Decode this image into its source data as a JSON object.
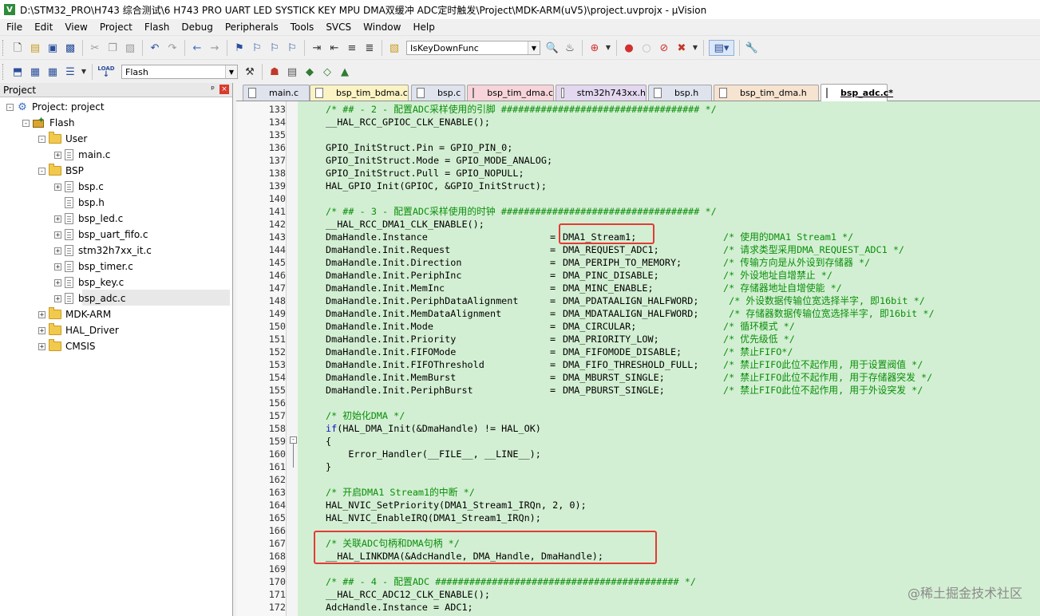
{
  "window": {
    "title": "D:\\STM32_PRO\\H743 综合测试\\6 H743 PRO UART LED SYSTICK KEY MPU DMA双缓冲 ADC定时触发\\Project\\MDK-ARM(uV5)\\project.uvprojx - µVision",
    "app_icon": "V"
  },
  "menu": [
    "File",
    "Edit",
    "View",
    "Project",
    "Flash",
    "Debug",
    "Peripherals",
    "Tools",
    "SVCS",
    "Window",
    "Help"
  ],
  "toolbar": {
    "find_combo_value": "IsKeyDownFunc",
    "target_combo_value": "Flash",
    "load_label": "LOAD"
  },
  "project_panel": {
    "header": "Project",
    "pin_glyph": "ᵖ",
    "close_glyph": "×",
    "tree": [
      {
        "label": "Project: project",
        "level": 0,
        "expander": "-",
        "icon": "project-icon"
      },
      {
        "label": "Flash",
        "level": 1,
        "expander": "-",
        "icon": "target-icon"
      },
      {
        "label": "User",
        "level": 2,
        "expander": "-",
        "icon": "folder-icon"
      },
      {
        "label": "main.c",
        "level": 3,
        "expander": "+",
        "icon": "file-icon"
      },
      {
        "label": "BSP",
        "level": 2,
        "expander": "-",
        "icon": "folder-icon"
      },
      {
        "label": "bsp.c",
        "level": 3,
        "expander": "+",
        "icon": "file-icon"
      },
      {
        "label": "bsp.h",
        "level": 3,
        "expander": "",
        "icon": "file-icon"
      },
      {
        "label": "bsp_led.c",
        "level": 3,
        "expander": "+",
        "icon": "file-icon"
      },
      {
        "label": "bsp_uart_fifo.c",
        "level": 3,
        "expander": "+",
        "icon": "file-icon"
      },
      {
        "label": "stm32h7xx_it.c",
        "level": 3,
        "expander": "+",
        "icon": "file-icon"
      },
      {
        "label": "bsp_timer.c",
        "level": 3,
        "expander": "+",
        "icon": "file-icon"
      },
      {
        "label": "bsp_key.c",
        "level": 3,
        "expander": "+",
        "icon": "file-icon"
      },
      {
        "label": "bsp_adc.c",
        "level": 3,
        "expander": "+",
        "icon": "file-icon"
      },
      {
        "label": "MDK-ARM",
        "level": 2,
        "expander": "+",
        "icon": "folder-icon"
      },
      {
        "label": "HAL_Driver",
        "level": 2,
        "expander": "+",
        "icon": "folder-icon"
      },
      {
        "label": "CMSIS",
        "level": 2,
        "expander": "+",
        "icon": "folder-icon"
      }
    ]
  },
  "tabs": [
    {
      "label": "main.c",
      "color": "#dfe3ee",
      "active": false
    },
    {
      "label": "bsp_tim_bdma.c",
      "color": "#fbf3c4",
      "active": false
    },
    {
      "label": "bsp.c",
      "color": "#dfe3ee",
      "active": false
    },
    {
      "label": "bsp_tim_dma.c",
      "color": "#f7d4da",
      "active": false
    },
    {
      "label": "stm32h743xx.h",
      "color": "#e4d8f0",
      "active": false
    },
    {
      "label": "bsp.h",
      "color": "#dfe3ee",
      "active": false
    },
    {
      "label": "bsp_tim_dma.h",
      "color": "#f6e3d0",
      "active": false
    },
    {
      "label": "bsp_adc.c*",
      "color": "#ffffff",
      "active": true
    }
  ],
  "editor": {
    "background": "#d3efd3",
    "lines": [
      {
        "n": "133",
        "code": "/* ## - 2 - 配置ADC采样使用的引脚 ################################### */",
        "cls": "cm"
      },
      {
        "n": "134",
        "code": "__HAL_RCC_GPIOC_CLK_ENABLE();",
        "cls": ""
      },
      {
        "n": "135",
        "code": "",
        "cls": ""
      },
      {
        "n": "136",
        "code": "GPIO_InitStruct.Pin = GPIO_PIN_0;",
        "cls": ""
      },
      {
        "n": "137",
        "code": "GPIO_InitStruct.Mode = GPIO_MODE_ANALOG;",
        "cls": ""
      },
      {
        "n": "138",
        "code": "GPIO_InitStruct.Pull = GPIO_NOPULL;",
        "cls": ""
      },
      {
        "n": "139",
        "code": "HAL_GPIO_Init(GPIOC, &GPIO_InitStruct);",
        "cls": ""
      },
      {
        "n": "140",
        "code": "",
        "cls": ""
      },
      {
        "n": "141",
        "code": "/* ## - 3 - 配置ADC采样使用的时钟 ################################### */",
        "cls": "cm"
      },
      {
        "n": "142",
        "code": "__HAL_RCC_DMA1_CLK_ENABLE();",
        "cls": ""
      },
      {
        "n": "143",
        "code": "DmaHandle.Instance",
        "val": "DMA1_Stream1;",
        "cmt": "/* 使用的DMA1 Stream1 */"
      },
      {
        "n": "144",
        "code": "DmaHandle.Init.Request",
        "val": "DMA_REQUEST_ADC1;",
        "cmt": "/* 请求类型采用DMA_REQUEST_ADC1 */"
      },
      {
        "n": "145",
        "code": "DmaHandle.Init.Direction",
        "val": "DMA_PERIPH_TO_MEMORY;",
        "cmt": "/* 传输方向是从外设到存储器 */"
      },
      {
        "n": "146",
        "code": "DmaHandle.Init.PeriphInc",
        "val": "DMA_PINC_DISABLE;",
        "cmt": "/* 外设地址自增禁止 */"
      },
      {
        "n": "147",
        "code": "DmaHandle.Init.MemInc",
        "val": "DMA_MINC_ENABLE;",
        "cmt": "/* 存储器地址自增使能 */"
      },
      {
        "n": "148",
        "code": "DmaHandle.Init.PeriphDataAlignment",
        "val": "DMA_PDATAALIGN_HALFWORD;",
        "cmt": " /* 外设数据传输位宽选择半字, 即16bit */"
      },
      {
        "n": "149",
        "code": "DmaHandle.Init.MemDataAlignment",
        "val": "DMA_MDATAALIGN_HALFWORD;",
        "cmt": " /* 存储器数据传输位宽选择半字, 即16bit */"
      },
      {
        "n": "150",
        "code": "DmaHandle.Init.Mode",
        "val": "DMA_CIRCULAR;",
        "cmt": "/* 循环模式 */"
      },
      {
        "n": "151",
        "code": "DmaHandle.Init.Priority",
        "val": "DMA_PRIORITY_LOW;",
        "cmt": "/* 优先级低 */"
      },
      {
        "n": "152",
        "code": "DmaHandle.Init.FIFOMode",
        "val": "DMA_FIFOMODE_DISABLE;",
        "cmt": "/* 禁止FIFO*/"
      },
      {
        "n": "153",
        "code": "DmaHandle.Init.FIFOThreshold",
        "val": "DMA_FIFO_THRESHOLD_FULL;",
        "cmt": "/* 禁止FIFO此位不起作用, 用于设置阀值 */"
      },
      {
        "n": "154",
        "code": "DmaHandle.Init.MemBurst",
        "val": "DMA_MBURST_SINGLE;",
        "cmt": "/* 禁止FIFO此位不起作用, 用于存储器突发 */"
      },
      {
        "n": "155",
        "code": "DmaHandle.Init.PeriphBurst",
        "val": "DMA_PBURST_SINGLE;",
        "cmt": "/* 禁止FIFO此位不起作用, 用于外设突发 */"
      },
      {
        "n": "156",
        "code": "",
        "cls": ""
      },
      {
        "n": "157",
        "code": "/* 初始化DMA */",
        "cls": "cm"
      },
      {
        "n": "158",
        "code": "if(HAL_DMA_Init(&DmaHandle) != HAL_OK)",
        "cls": "if"
      },
      {
        "n": "159",
        "code": "{",
        "cls": ""
      },
      {
        "n": "160",
        "code": "    Error_Handler(__FILE__, __LINE__);",
        "cls": ""
      },
      {
        "n": "161",
        "code": "}",
        "cls": ""
      },
      {
        "n": "162",
        "code": "",
        "cls": ""
      },
      {
        "n": "163",
        "code": "/* 开启DMA1 Stream1的中断 */",
        "cls": "cm"
      },
      {
        "n": "164",
        "code": "HAL_NVIC_SetPriority(DMA1_Stream1_IRQn, 2, 0);",
        "cls": ""
      },
      {
        "n": "165",
        "code": "HAL_NVIC_EnableIRQ(DMA1_Stream1_IRQn);",
        "cls": ""
      },
      {
        "n": "166",
        "code": "",
        "cls": ""
      },
      {
        "n": "167",
        "code": "/* 关联ADC句柄和DMA句柄 */",
        "cls": "cm"
      },
      {
        "n": "168",
        "code": "__HAL_LINKDMA(&AdcHandle, DMA_Handle, DmaHandle);",
        "cls": ""
      },
      {
        "n": "169",
        "code": "",
        "cls": ""
      },
      {
        "n": "170",
        "code": "/* ## - 4 - 配置ADC ########################################### */",
        "cls": "cm"
      },
      {
        "n": "171",
        "code": "__HAL_RCC_ADC12_CLK_ENABLE();",
        "cls": ""
      },
      {
        "n": "172",
        "code": "AdcHandle.Instance = ADC1;",
        "cls": ""
      }
    ]
  },
  "watermark": "@稀土掘金技术社区"
}
